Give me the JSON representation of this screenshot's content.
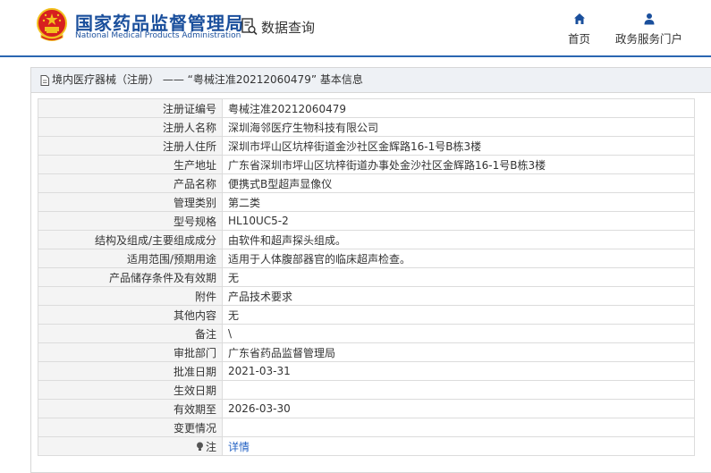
{
  "header": {
    "title_cn": "国家药品监督管理局",
    "title_en": "National Medical Products Administration",
    "query_label": "数据查询",
    "nav": [
      {
        "label": "首页",
        "icon": "home-icon"
      },
      {
        "label": "政务服务门户",
        "icon": "user-icon"
      }
    ]
  },
  "panel": {
    "title": "境内医疗器械（注册） —— “粤械注准20212060479” 基本信息"
  },
  "rows": [
    {
      "label": "注册证编号",
      "value": "粤械注准20212060479"
    },
    {
      "label": "注册人名称",
      "value": "深圳海邻医疗生物科技有限公司"
    },
    {
      "label": "注册人住所",
      "value": "深圳市坪山区坑梓街道金沙社区金辉路16-1号B栋3楼"
    },
    {
      "label": "生产地址",
      "value": "广东省深圳市坪山区坑梓街道办事处金沙社区金辉路16-1号B栋3楼"
    },
    {
      "label": "产品名称",
      "value": "便携式B型超声显像仪"
    },
    {
      "label": "管理类别",
      "value": "第二类"
    },
    {
      "label": "型号规格",
      "value": "HL10UC5-2"
    },
    {
      "label": "结构及组成/主要组成成分",
      "value": "由软件和超声探头组成。"
    },
    {
      "label": "适用范围/预期用途",
      "value": "适用于人体腹部器官的临床超声检查。"
    },
    {
      "label": "产品储存条件及有效期",
      "value": "无"
    },
    {
      "label": "附件",
      "value": "产品技术要求"
    },
    {
      "label": "其他内容",
      "value": "无"
    },
    {
      "label": "备注",
      "value": "\\"
    },
    {
      "label": "审批部门",
      "value": "广东省药品监督管理局"
    },
    {
      "label": "批准日期",
      "value": "2021-03-31"
    },
    {
      "label": "生效日期",
      "value": ""
    },
    {
      "label": "有效期至",
      "value": "2026-03-30"
    },
    {
      "label": "变更情况",
      "value": ""
    }
  ],
  "note_row": {
    "label": "注",
    "link": "详情",
    "icon": "lightbulb-icon"
  },
  "colors": {
    "brand_blue": "#1a4f9c",
    "accent_line": "#2b66b1",
    "link": "#2563c4",
    "emblem_red": "#d7201f",
    "emblem_gold": "#f2c01e"
  }
}
